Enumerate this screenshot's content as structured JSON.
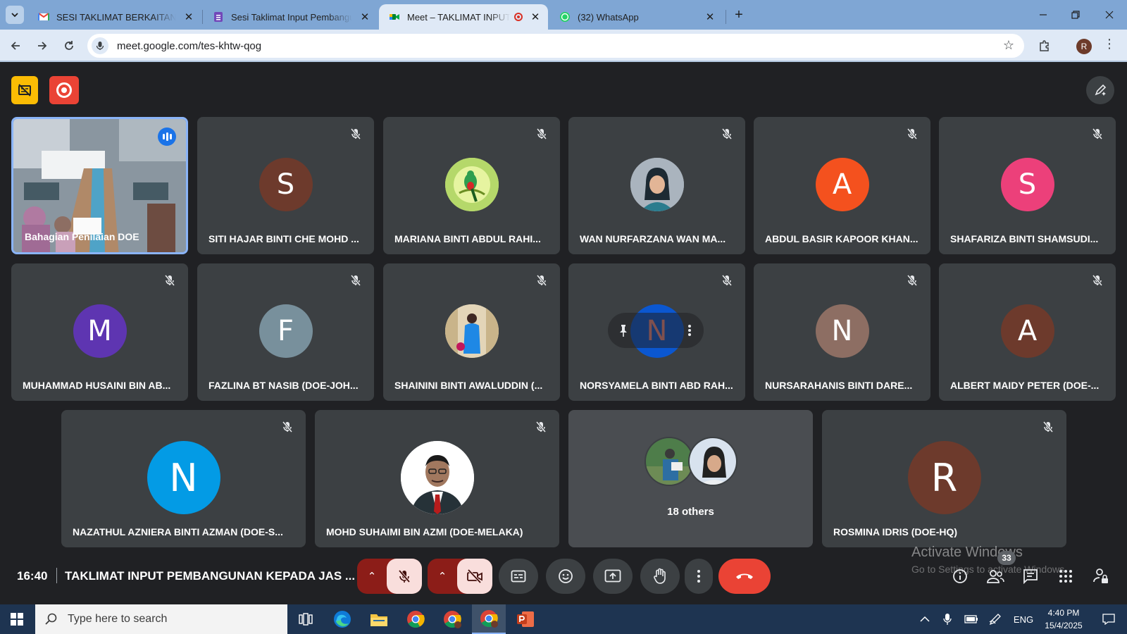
{
  "browser": {
    "tabs": [
      {
        "title": "SESI TAKLIMAT BERKAITAN INPUT",
        "favicon": "gmail-icon",
        "active": false
      },
      {
        "title": "Sesi Taklimat Input Pembangunan",
        "favicon": "forms-icon",
        "active": false
      },
      {
        "title": "Meet – TAKLIMAT INPUT PEMBANGUNAN",
        "favicon": "meet-icon",
        "active": true
      },
      {
        "title": "(32) WhatsApp",
        "favicon": "whatsapp-icon",
        "active": false
      }
    ],
    "url": "meet.google.com/tes-khtw-qog",
    "profile_initial": "R"
  },
  "meet": {
    "participants": [
      {
        "name": "Bahagian Penilaian DOE",
        "type": "video",
        "speaking": true
      },
      {
        "name": "SITI HAJAR BINTI CHE MOHD ...",
        "initial": "S",
        "color": "#6d3a2c"
      },
      {
        "name": "MARIANA BINTI ABDUL RAHI...",
        "type": "photo",
        "photo": "bird"
      },
      {
        "name": "WAN NURFARZANA WAN MA...",
        "type": "photo",
        "photo": "hijab"
      },
      {
        "name": "ABDUL BASIR KAPOOR KHAN...",
        "initial": "A",
        "color": "#f4511e"
      },
      {
        "name": "SHAFARIZA BINTI SHAMSUDI...",
        "initial": "S",
        "color": "#ec407a"
      },
      {
        "name": "MUHAMMAD HUSAINI BIN AB...",
        "initial": "M",
        "color": "#5e35b1"
      },
      {
        "name": "FAZLINA BT NASIB (DOE-JOH...",
        "initial": "F",
        "color": "#78909c"
      },
      {
        "name": "SHAININI BINTI AWALUDDIN (...",
        "type": "photo",
        "photo": "standing"
      },
      {
        "name": "NORSYAMELA BINTI ABD RAH...",
        "initial": "N",
        "color": "#0b57d0",
        "hovered": true
      },
      {
        "name": "NURSARAHANIS BINTI DARE...",
        "initial": "N",
        "color": "#8d6e63"
      },
      {
        "name": "ALBERT MAIDY PETER (DOE-...",
        "initial": "A",
        "color": "#6d3a2c"
      },
      {
        "name": "NAZATHUL AZNIERA BINTI AZMAN (DOE-S...",
        "initial": "N",
        "color": "#039be5"
      },
      {
        "name": "MOHD SUHAIMI BIN AZMI (DOE-MELAKA)",
        "type": "photo",
        "photo": "suit"
      },
      {
        "name": "18 others",
        "type": "others"
      },
      {
        "name": "ROSMINA IDRIS (DOE-HQ)",
        "initial": "R",
        "color": "#6d3a2c"
      }
    ],
    "time": "16:40",
    "title": "TAKLIMAT INPUT PEMBANGUNAN KEPADA JAS ...",
    "participant_count": "33",
    "watermark_title": "Activate Windows",
    "watermark_sub": "Go to Settings to activate Windows."
  },
  "taskbar": {
    "search_placeholder": "Type here to search",
    "lang": "ENG",
    "time": "4:40 PM",
    "date": "15/4/2025"
  },
  "colors": {
    "meet_bg": "#202124",
    "tile_bg": "#3c4043",
    "end_call": "#ea4335",
    "active_speaker": "#8ab4f8"
  }
}
